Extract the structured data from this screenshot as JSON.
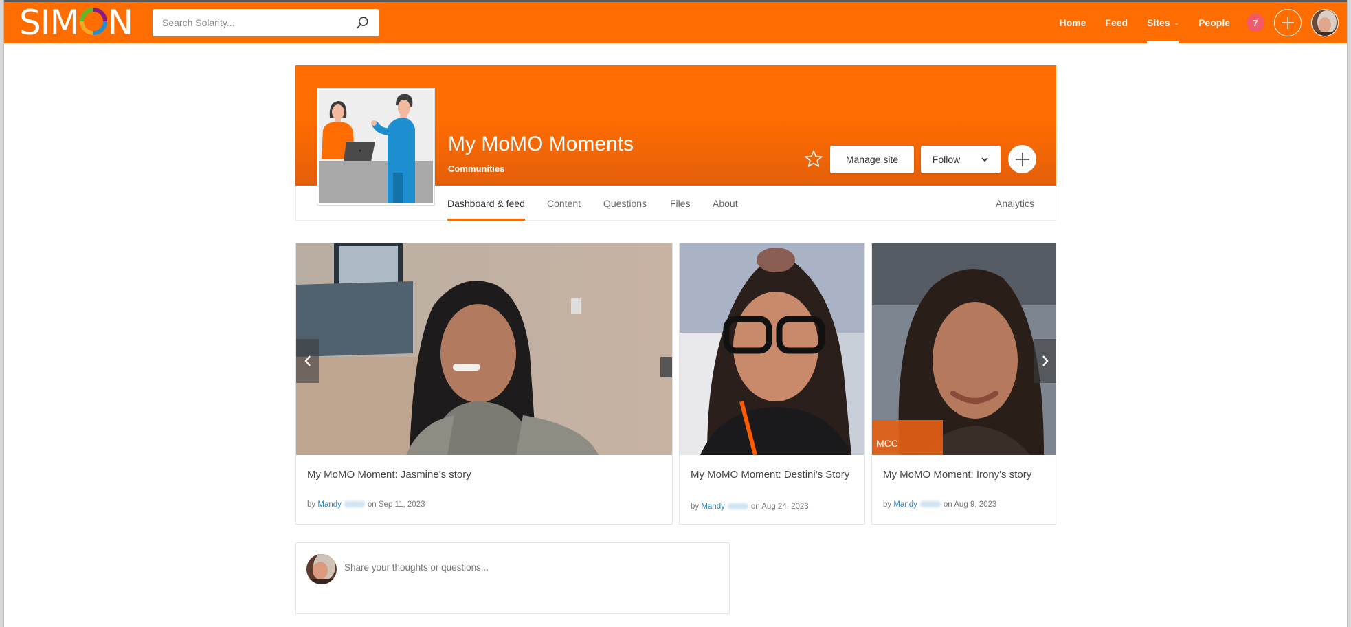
{
  "app": {
    "logo_text_left": "SIM",
    "logo_text_right": "N",
    "logo_ring_colors": [
      "#8a1b83",
      "#1e8fd1",
      "#f5a623",
      "#5cb82d"
    ],
    "brand_color": "#ff6c00"
  },
  "navbar": {
    "search": {
      "placeholder": "Search Solarity...",
      "value": ""
    },
    "links": [
      {
        "label": "Home"
      },
      {
        "label": "Feed"
      },
      {
        "label": "Sites",
        "active": true,
        "has_dropdown": true
      },
      {
        "label": "People"
      }
    ],
    "notification_count": "7",
    "plus_icon": "plus-icon",
    "user_avatar": "user-avatar"
  },
  "site": {
    "title": "My MoMO Moments",
    "type": "Communities",
    "actions": {
      "favorite_icon": "star-outline-icon",
      "manage_label": "Manage site",
      "follow_label": "Follow",
      "add_icon": "plus-icon"
    },
    "tabs": [
      {
        "label": "Dashboard & feed",
        "active": true
      },
      {
        "label": "Content"
      },
      {
        "label": "Questions"
      },
      {
        "label": "Files"
      },
      {
        "label": "About"
      },
      {
        "label": "Analytics"
      }
    ]
  },
  "carousel": {
    "prev_icon": "chevron-left-icon",
    "next_icon": "chevron-right-icon",
    "cards": [
      {
        "title": "My MoMO Moment: Jasmine's story",
        "by": "by",
        "author": "Mandy",
        "on": "on",
        "date": "Sep 11, 2023"
      },
      {
        "title": "My MoMO Moment: Destini's Story",
        "by": "by",
        "author": "Mandy",
        "on": "on",
        "date": "Aug 24, 2023"
      },
      {
        "title": "My MoMO Moment: Irony's story",
        "by": "by",
        "author": "Mandy",
        "on": "on",
        "date": "Aug 9, 2023",
        "overlay_label": "MCC"
      }
    ]
  },
  "composer": {
    "placeholder": "Share your thoughts or questions..."
  }
}
